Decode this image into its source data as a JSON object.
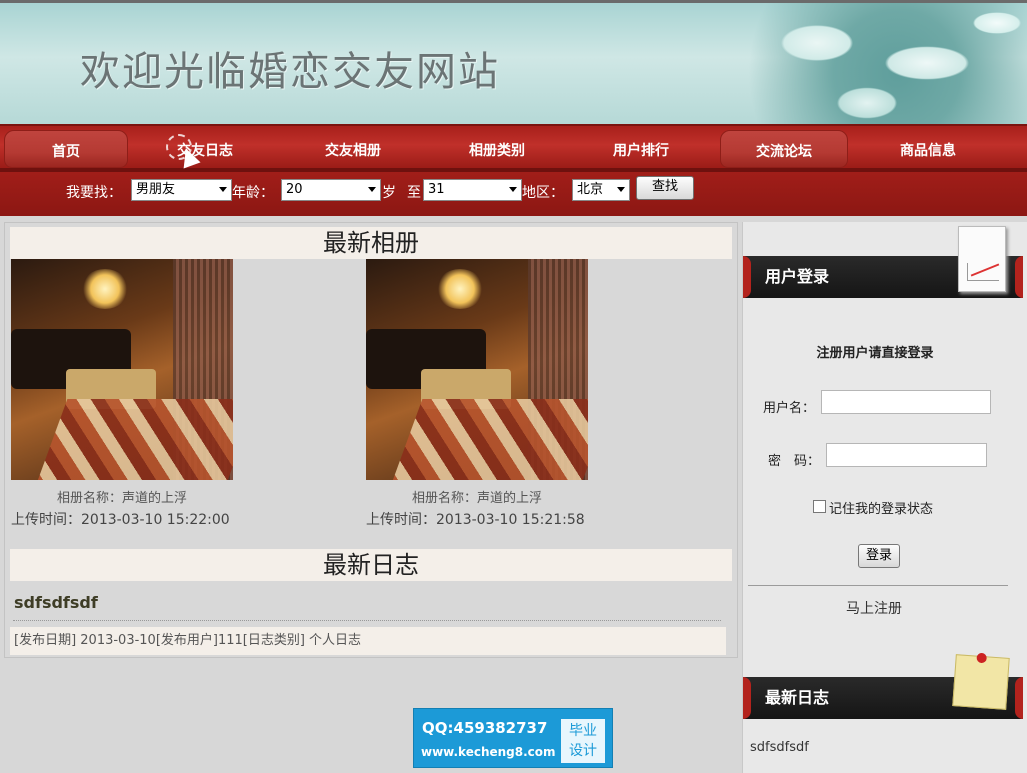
{
  "banner": {
    "title": "欢迎光临婚恋交友网站"
  },
  "nav": {
    "items": [
      {
        "label": "首页"
      },
      {
        "label": "交友日志"
      },
      {
        "label": "交友相册"
      },
      {
        "label": "相册类别"
      },
      {
        "label": "用户排行"
      },
      {
        "label": "交流论坛"
      },
      {
        "label": "商品信息"
      }
    ]
  },
  "search": {
    "find_label": "我要找：",
    "gender_value": "男朋友",
    "age_label": "年龄：",
    "age_from": "20",
    "age_unit": "岁",
    "to_label": "至",
    "age_to": "31",
    "region_label": "地区：",
    "region_value": "北京",
    "button": "查找"
  },
  "albums": {
    "heading": "最新相册",
    "items": [
      {
        "name": "相册名称：声道的上浮",
        "time": "上传时间：2013-03-10 15:22:00"
      },
      {
        "name": "相册名称：声道的上浮",
        "time": "上传时间：2013-03-10 15:21:58"
      }
    ]
  },
  "blogs": {
    "heading": "最新日志",
    "title": "sdfsdfsdf",
    "meta": "[发布日期] 2013-03-10[发布用户]111[日志类别] 个人日志"
  },
  "sidebar": {
    "login_title": "用户登录",
    "login_tip": "注册用户请直接登录",
    "username_label": "用户名：",
    "password_label": "密　码：",
    "remember_label": "记住我的登录状态",
    "login_button": "登录",
    "register_link": "马上注册",
    "latest_blog_title": "最新日志",
    "latest_blog_item": "sdfsdfsdf"
  },
  "qq_badge": {
    "qq": "QQ:459382737",
    "url": "www.kecheng8.com",
    "tag_line1": "毕业",
    "tag_line2": "设计"
  },
  "colors": {
    "nav_red": "#b3231d",
    "banner_teal": "#a9d4d3",
    "qq_blue": "#1c9ad7"
  }
}
